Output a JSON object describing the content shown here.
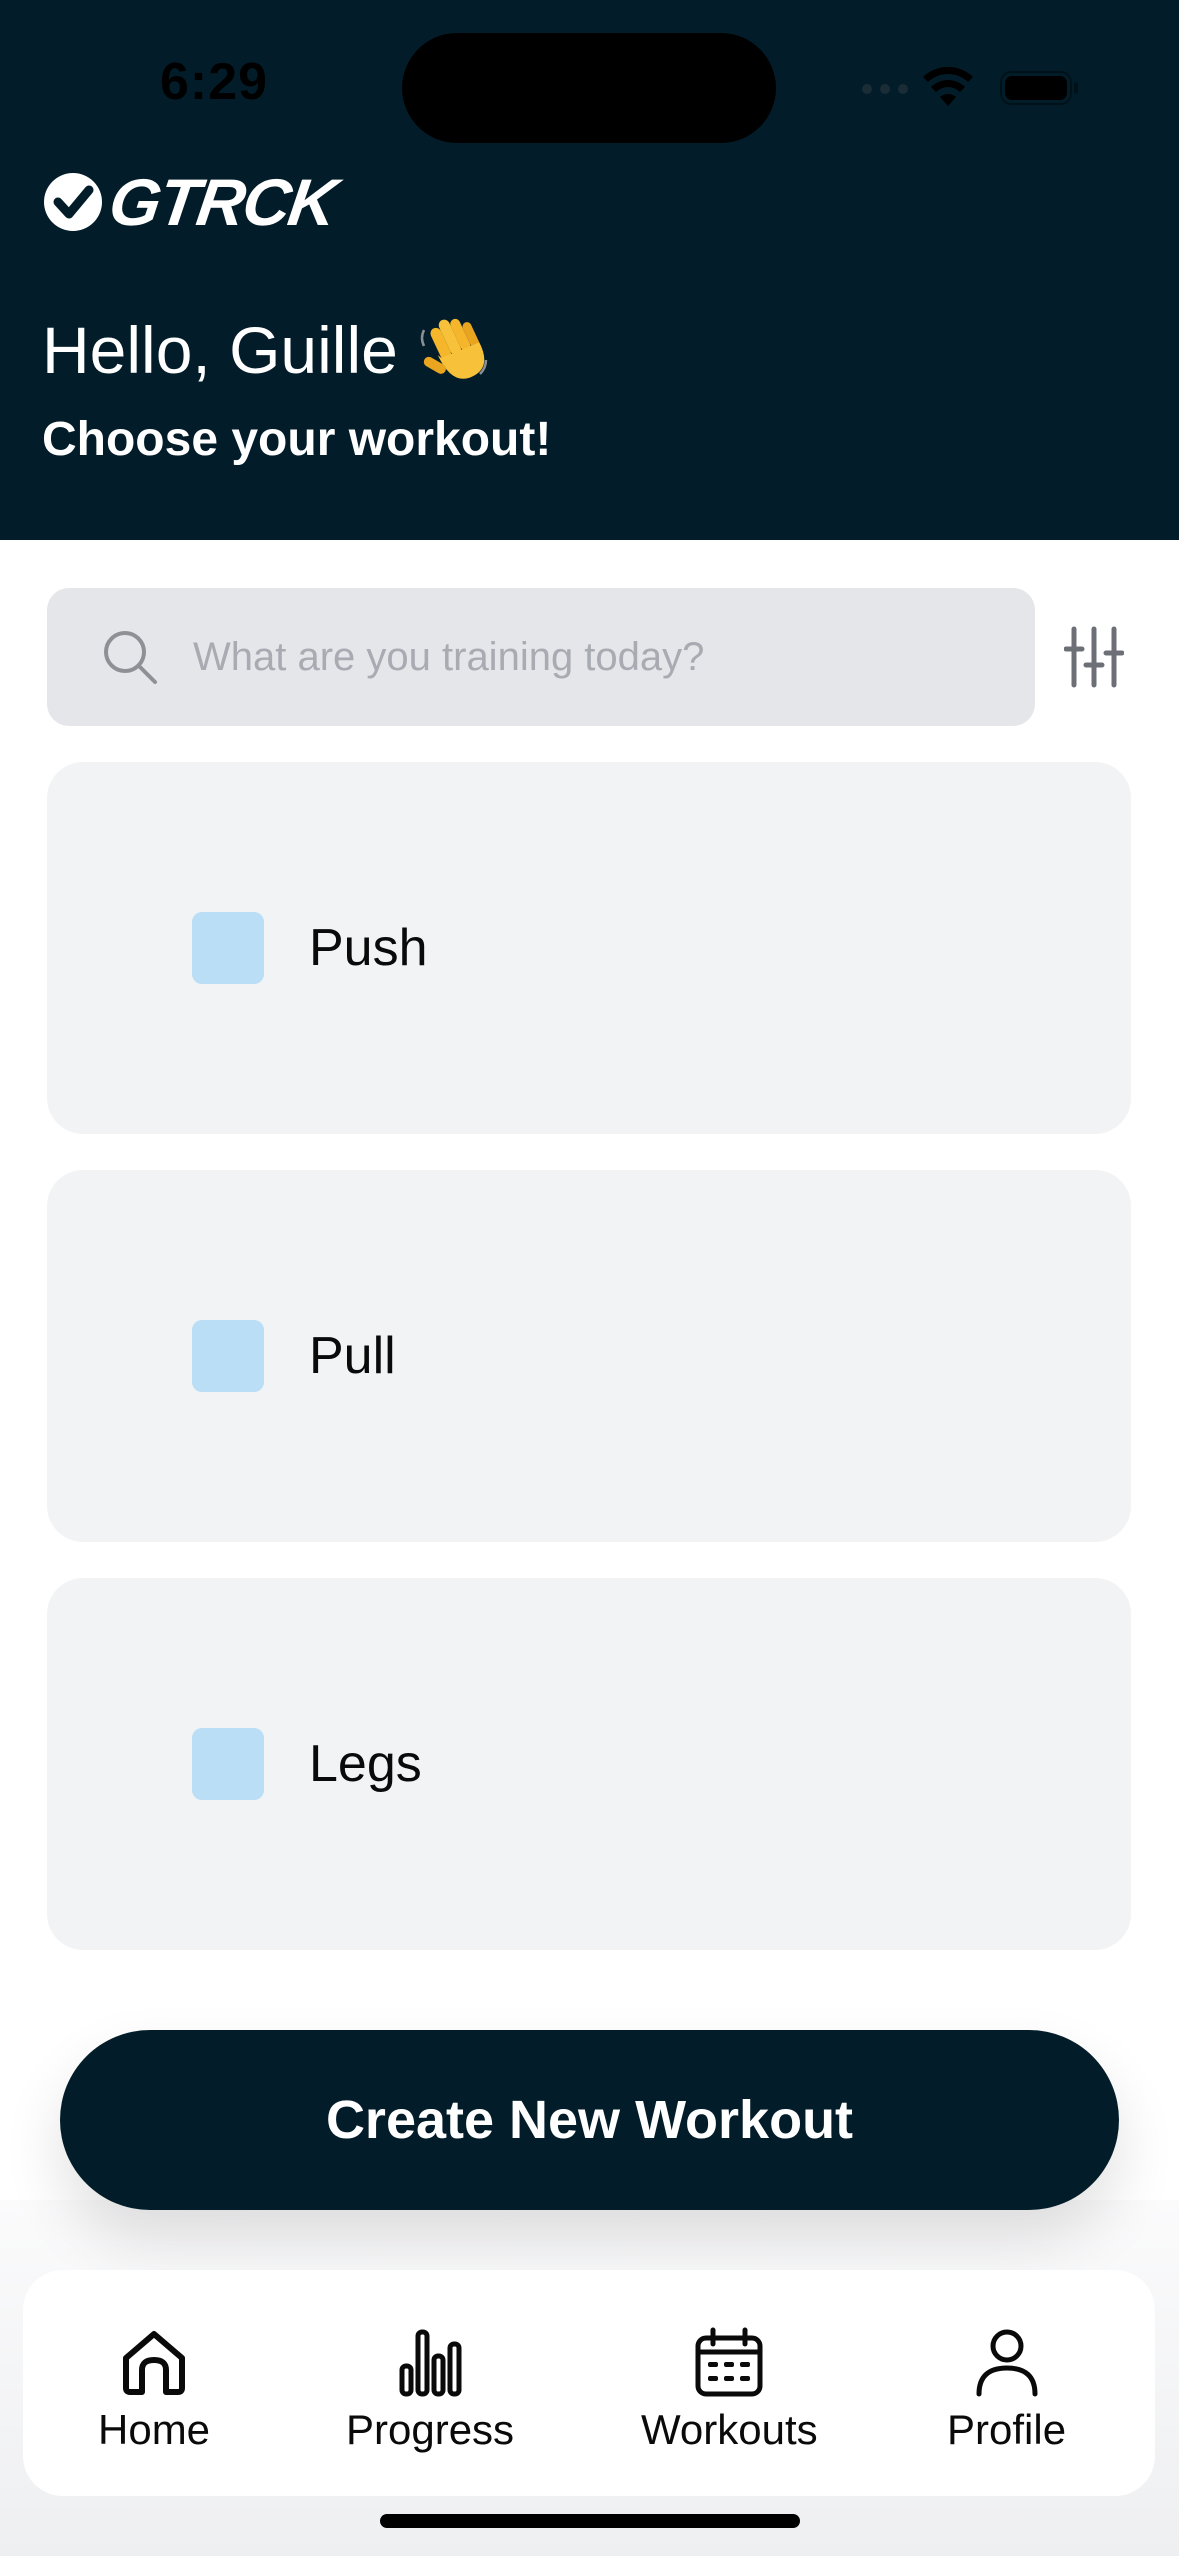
{
  "status_bar": {
    "time": "6:29"
  },
  "brand": {
    "logo_text": "GTRCK"
  },
  "header": {
    "greeting": "Hello, Guille",
    "greeting_icon": "waving-hand-icon",
    "subtitle": "Choose your workout!"
  },
  "search": {
    "placeholder": "What are you training today?",
    "value": ""
  },
  "workouts": [
    {
      "label": "Push",
      "color": "#b9def5"
    },
    {
      "label": "Pull",
      "color": "#b9def5"
    },
    {
      "label": "Legs",
      "color": "#b9def5"
    }
  ],
  "create_button": {
    "label": "Create New Workout"
  },
  "tabs": [
    {
      "label": "Home",
      "icon": "home-icon"
    },
    {
      "label": "Progress",
      "icon": "bar-chart-icon"
    },
    {
      "label": "Workouts",
      "icon": "calendar-icon"
    },
    {
      "label": "Profile",
      "icon": "user-icon"
    }
  ],
  "colors": {
    "primary": "#021d29",
    "accent": "#b9def5",
    "card": "#f2f3f5"
  }
}
